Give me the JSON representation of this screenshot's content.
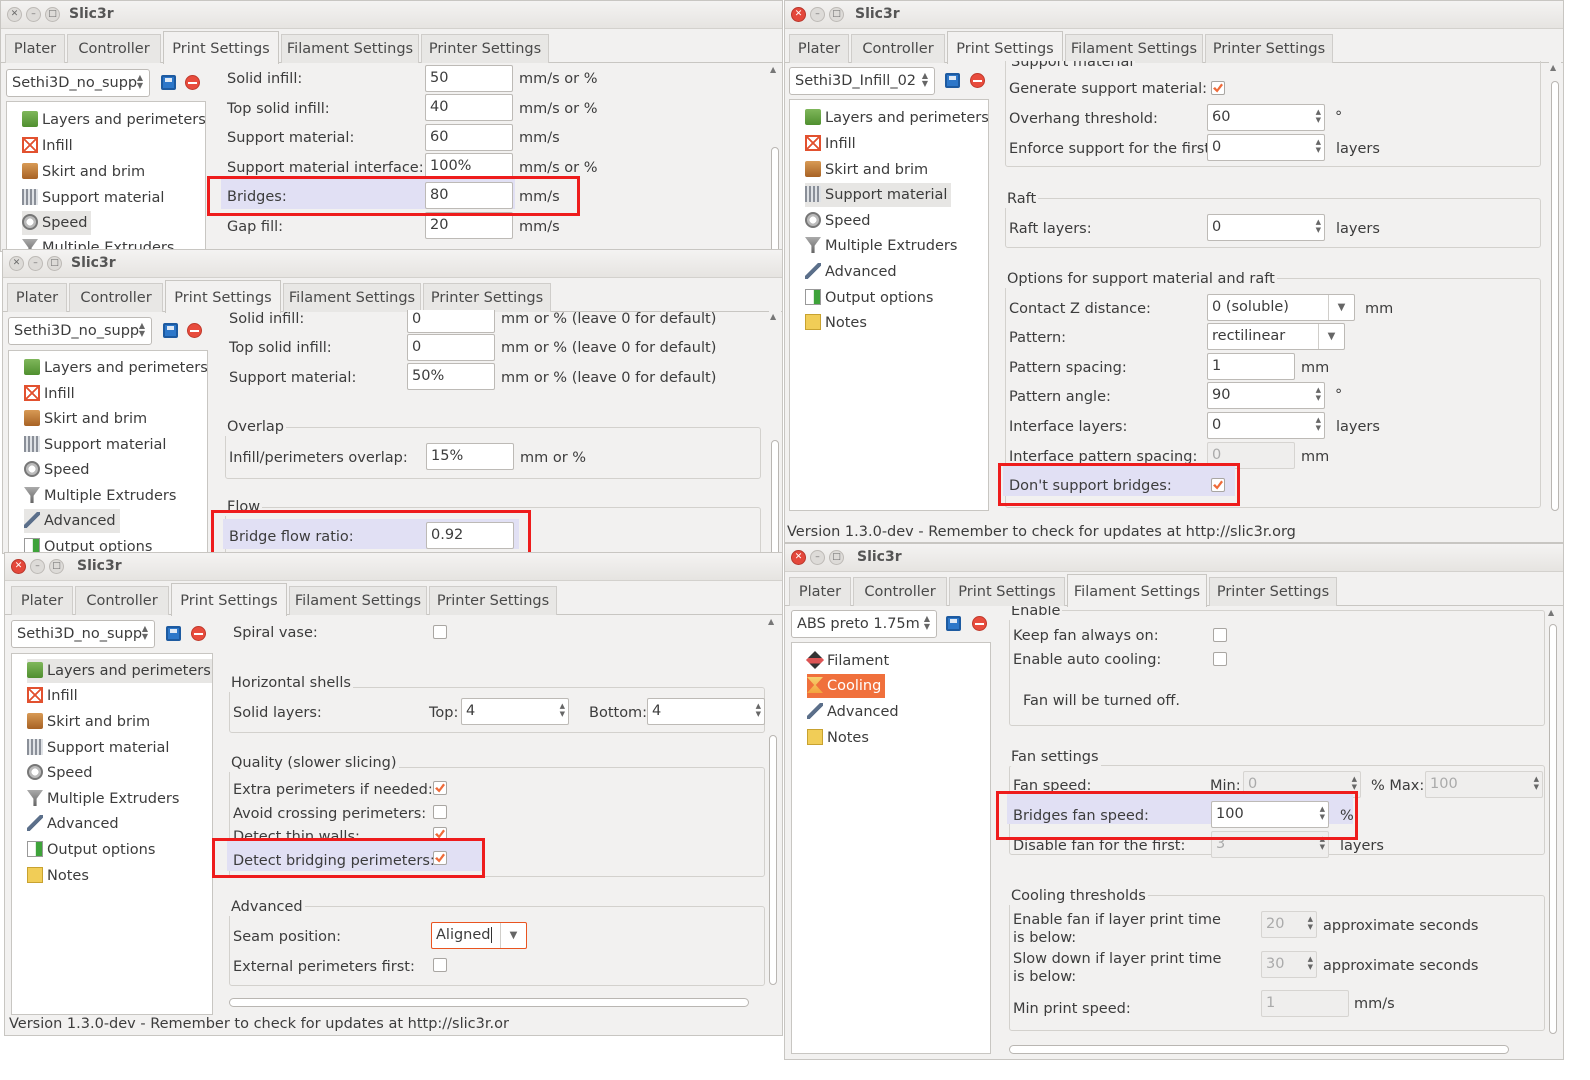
{
  "app_title": "Slic3r",
  "tabs": [
    "Plater",
    "Controller",
    "Print Settings",
    "Filament Settings",
    "Printer Settings"
  ],
  "print_tree": [
    "Layers and perimeters",
    "Infill",
    "Skirt and brim",
    "Support material",
    "Speed",
    "Multiple Extruders",
    "Advanced",
    "Output options",
    "Notes"
  ],
  "filament_tree": [
    "Filament",
    "Cooling",
    "Advanced",
    "Notes"
  ],
  "status_text": "Version 1.3.0-dev - Remember to check for updates at http://slic3r.or",
  "status_text_rt": "Version 1.3.0-dev - Remember to check for updates at http://slic3r.org",
  "colors": {
    "highlight_box": "#ee1c1c",
    "highlight_row": "#e1e0f4",
    "selected_orange": "#f0703c"
  },
  "w1": {
    "preset": "Sethi3D_no_supp",
    "tree_visible": [
      "Layers and perimeters",
      "Infill",
      "Skirt and brim",
      "Support material",
      "Speed",
      "Multiple Extruders"
    ],
    "rows": [
      {
        "label": "Solid infill:",
        "value": "50",
        "unit": "mm/s or %"
      },
      {
        "label": "Top solid infill:",
        "value": "40",
        "unit": "mm/s or %"
      },
      {
        "label": "Support material:",
        "value": "60",
        "unit": "mm/s"
      },
      {
        "label": "Support material interface:",
        "value": "100%",
        "unit": "mm/s or %"
      },
      {
        "label": "Bridges:",
        "value": "80",
        "unit": "mm/s"
      },
      {
        "label": "Gap fill:",
        "value": "20",
        "unit": "mm/s"
      }
    ]
  },
  "w2": {
    "preset": "Sethi3D_no_supp",
    "rows": [
      {
        "label": "Solid infill:",
        "value": "0",
        "unit": "mm or % (leave 0 for default)"
      },
      {
        "label": "Top solid infill:",
        "value": "0",
        "unit": "mm or % (leave 0 for default)"
      },
      {
        "label": "Support material:",
        "value": "50%",
        "unit": "mm or % (leave 0 for default)"
      }
    ],
    "overlap_title": "Overlap",
    "overlap_label": "Infill/perimeters overlap:",
    "overlap_value": "15%",
    "overlap_unit": "mm or %",
    "flow_title": "Flow",
    "bridge_flow_label": "Bridge flow ratio:",
    "bridge_flow_value": "0.92"
  },
  "w3": {
    "preset": "Sethi3D_no_supp",
    "spiral_vase": "Spiral vase:",
    "horizontal_shells": "Horizontal shells",
    "solid_layers": "Solid layers:",
    "top_label": "Top:",
    "top_value": "4",
    "bottom_label": "Bottom:",
    "bottom_value": "4",
    "quality_title": "Quality (slower slicing)",
    "extra_perimeters": "Extra perimeters if needed:",
    "avoid_crossing": "Avoid crossing perimeters:",
    "detect_thin": "Detect thin walls:",
    "detect_bridging": "Detect bridging perimeters:",
    "advanced_title": "Advanced",
    "seam_label": "Seam position:",
    "seam_value": "Aligned",
    "external_first": "External perimeters first:"
  },
  "w4": {
    "preset": "Sethi3D_Infill_02",
    "cut_title": "Support material",
    "generate": "Generate support material:",
    "overhang": "Overhang threshold:",
    "overhang_value": "60",
    "overhang_unit": "°",
    "enforce": "Enforce support for the first:",
    "enforce_value": "0",
    "layers_unit": "layers",
    "raft_title": "Raft",
    "raft_layers": "Raft layers:",
    "raft_value": "0",
    "options_title": "Options for support material and raft",
    "contact_z": "Contact Z distance:",
    "contact_z_value": "0 (soluble)",
    "mm_unit": "mm",
    "pattern": "Pattern:",
    "pattern_value": "rectilinear",
    "pattern_spacing": "Pattern spacing:",
    "pattern_spacing_value": "1",
    "pattern_angle": "Pattern angle:",
    "pattern_angle_value": "90",
    "interface_layers": "Interface layers:",
    "interface_layers_value": "0",
    "interface_spacing": "Interface pattern spacing:",
    "interface_spacing_value": "0",
    "dont_support": "Don't support bridges:"
  },
  "w5": {
    "preset": "ABS preto 1.75m",
    "enable_title": "Enable",
    "keep_fan": "Keep fan always on:",
    "auto_cool": "Enable auto cooling:",
    "fan_off": "Fan will be turned off.",
    "fan_settings": "Fan settings",
    "fan_speed": "Fan speed:",
    "min_label": "Min:",
    "min_value": "0",
    "max_label": "% Max:",
    "max_value": "100",
    "bridges_fan": "Bridges fan speed:",
    "bridges_fan_value": "100",
    "pct": "%",
    "disable_fan": "Disable fan for the first:",
    "disable_fan_value": "3",
    "layers": "layers",
    "cooling_thresholds": "Cooling thresholds",
    "enable_fan_if": "Enable fan if layer print time is below:",
    "enable_fan_value": "20",
    "slow_down_if": "Slow down if layer print time is below:",
    "slow_down_value": "30",
    "approx_seconds": "approximate seconds",
    "min_print_speed": "Min print speed:",
    "min_print_speed_value": "1",
    "mms": "mm/s"
  }
}
